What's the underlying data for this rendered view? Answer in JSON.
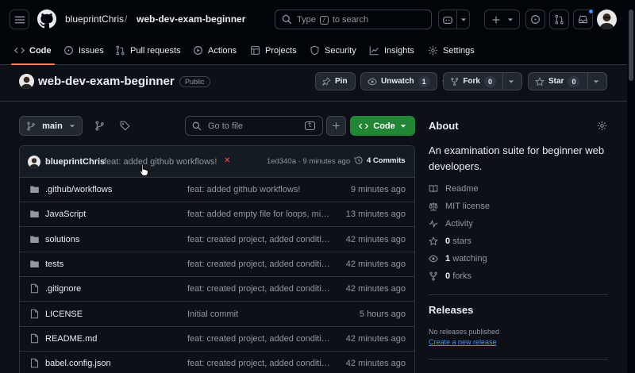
{
  "header": {
    "owner": "blueprintChris",
    "separator": "/",
    "repo": "web-dev-exam-beginner",
    "search": {
      "type_label": "Type",
      "key": "/",
      "suffix": "to search"
    }
  },
  "tabs": [
    {
      "label": "Code",
      "icon": "code-icon"
    },
    {
      "label": "Issues",
      "icon": "issue-icon"
    },
    {
      "label": "Pull requests",
      "icon": "pull-request-icon"
    },
    {
      "label": "Actions",
      "icon": "play-icon"
    },
    {
      "label": "Projects",
      "icon": "table-icon"
    },
    {
      "label": "Security",
      "icon": "shield-icon"
    },
    {
      "label": "Insights",
      "icon": "graph-icon"
    },
    {
      "label": "Settings",
      "icon": "gear-icon"
    }
  ],
  "repo": {
    "title": "web-dev-exam-beginner",
    "visibility": "Public",
    "pin_label": "Pin",
    "unwatch_label": "Unwatch",
    "unwatch_count": "1",
    "fork_label": "Fork",
    "fork_count": "0",
    "star_label": "Star",
    "star_count": "0"
  },
  "toolbar": {
    "branch": "main",
    "goto_placeholder": "Go to file",
    "goto_key": "t",
    "code_label": "Code"
  },
  "commit": {
    "author": "blueprintChris",
    "message": "feat: added github workflows!",
    "status": "✕",
    "hash_time": "1ed340a · 9 minutes ago",
    "commits_label": "4 Commits"
  },
  "files": [
    {
      "name": ".github/workflows",
      "type": "dir",
      "message": "feat: added github workflows!",
      "time": "9 minutes ago"
    },
    {
      "name": "JavaScript",
      "type": "dir",
      "message": "feat: added empty file for loops, min...",
      "time": "13 minutes ago"
    },
    {
      "name": "solutions",
      "type": "dir",
      "message": "feat: created project, added conditio...",
      "time": "42 minutes ago"
    },
    {
      "name": "tests",
      "type": "dir",
      "message": "feat: created project, added conditio...",
      "time": "42 minutes ago"
    },
    {
      "name": ".gitignore",
      "type": "file",
      "message": "feat: created project, added conditio...",
      "time": "42 minutes ago"
    },
    {
      "name": "LICENSE",
      "type": "file",
      "message": "Initial commit",
      "time": "5 hours ago"
    },
    {
      "name": "README.md",
      "type": "file",
      "message": "feat: created project, added conditio...",
      "time": "42 minutes ago"
    },
    {
      "name": "babel.config.json",
      "type": "file",
      "message": "feat: created project, added conditio...",
      "time": "42 minutes ago"
    }
  ],
  "about": {
    "heading": "About",
    "description": "An examination suite for beginner web developers.",
    "items": [
      {
        "icon": "book-icon",
        "value": "",
        "label": "Readme"
      },
      {
        "icon": "law-icon",
        "value": "",
        "label": "MIT license"
      },
      {
        "icon": "pulse-icon",
        "value": "",
        "label": "Activity"
      },
      {
        "icon": "star-icon",
        "value": "0",
        "label": "stars"
      },
      {
        "icon": "eye-icon",
        "value": "1",
        "label": "watching"
      },
      {
        "icon": "fork-icon",
        "value": "0",
        "label": "forks"
      }
    ]
  },
  "releases": {
    "heading": "Releases",
    "none_text": "No releases published",
    "create_link": "Create a new release"
  },
  "colors": {
    "bg": "#0d1117",
    "header_bg": "#010409",
    "accent_tab": "#f78166",
    "code_button": "#238636",
    "link": "#4493f8",
    "fail": "#f85149",
    "folder": "#9198a1"
  }
}
